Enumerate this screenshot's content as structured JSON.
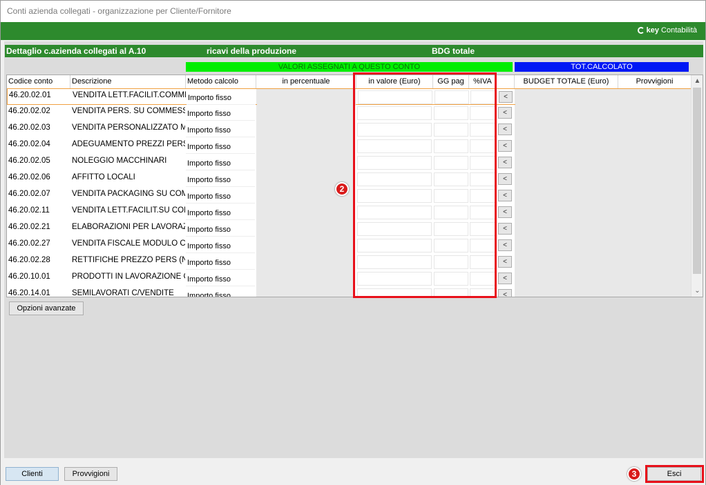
{
  "window": {
    "title": "Conti azienda collegati - organizzazione per Cliente/Fornitore",
    "brand_bold": "key",
    "brand_rest": "Contabilità"
  },
  "header": {
    "dettaglio": "Dettaglio c.azienda collegati al  A.10",
    "ricavi": "ricavi della produzione",
    "bdg": "BDG totale"
  },
  "sections": {
    "valori": "VALORI ASSEGNATI A QUESTO CONTO",
    "tot": "TOT.CALCOLATO"
  },
  "columns": {
    "codice": "Codice conto",
    "descrizione": "Descrizione",
    "metodo": "Metodo calcolo",
    "percentuale": "in percentuale",
    "valore": "in valore (Euro)",
    "gg": "GG pag",
    "iva": "%IVA",
    "budget": "BUDGET TOTALE (Euro)",
    "provvigioni": "Provvigioni"
  },
  "rows": [
    {
      "code": "46.20.02.01",
      "desc": "VENDITA LETT.FACILIT.COMME",
      "metodo": "Importo fisso"
    },
    {
      "code": "46.20.02.02",
      "desc": "VENDITA PERS. SU COMMESSA",
      "metodo": "Importo fisso"
    },
    {
      "code": "46.20.02.03",
      "desc": "VENDITA PERSONALIZZATO MA",
      "metodo": "Importo fisso"
    },
    {
      "code": "46.20.02.04",
      "desc": "ADEGUAMENTO PREZZI PERS.",
      "metodo": "Importo fisso"
    },
    {
      "code": "46.20.02.05",
      "desc": "NOLEGGIO MACCHINARI",
      "metodo": "Importo fisso"
    },
    {
      "code": "46.20.02.06",
      "desc": "AFFITTO LOCALI",
      "metodo": "Importo fisso"
    },
    {
      "code": "46.20.02.07",
      "desc": "VENDITA PACKAGING SU COMM",
      "metodo": "Importo fisso"
    },
    {
      "code": "46.20.02.11",
      "desc": "VENDITA LETT.FACILIT.SU COM",
      "metodo": "Importo fisso"
    },
    {
      "code": "46.20.02.21",
      "desc": "ELABORAZIONI PER LAVORAZ.I",
      "metodo": "Importo fisso"
    },
    {
      "code": "46.20.02.27",
      "desc": "VENDITA FISCALE MODULO C. C",
      "metodo": "Importo fisso"
    },
    {
      "code": "46.20.02.28",
      "desc": "RETTIFICHE PREZZO PERS (NC",
      "metodo": "Importo fisso"
    },
    {
      "code": "46.20.10.01",
      "desc": "PRODOTTI IN LAVORAZIONE C/",
      "metodo": "Importo fisso"
    },
    {
      "code": "46.20.14.01",
      "desc": "SEMILAVORATI C/VENDITE",
      "metodo": "Importo fisso"
    }
  ],
  "row_button": "<",
  "scroll": {
    "up": "▲",
    "down": "⌄"
  },
  "buttons": {
    "opzioni": "Opzioni avanzate",
    "clienti": "Clienti",
    "provvigioni": "Provvigioni",
    "esci": "Esci"
  },
  "badges": {
    "two": "2",
    "three": "3"
  },
  "colors": {
    "green_header": "#2d8a2d",
    "section_green": "#00ee00",
    "section_blue": "#0018f5",
    "highlight_red": "#e8101a"
  }
}
